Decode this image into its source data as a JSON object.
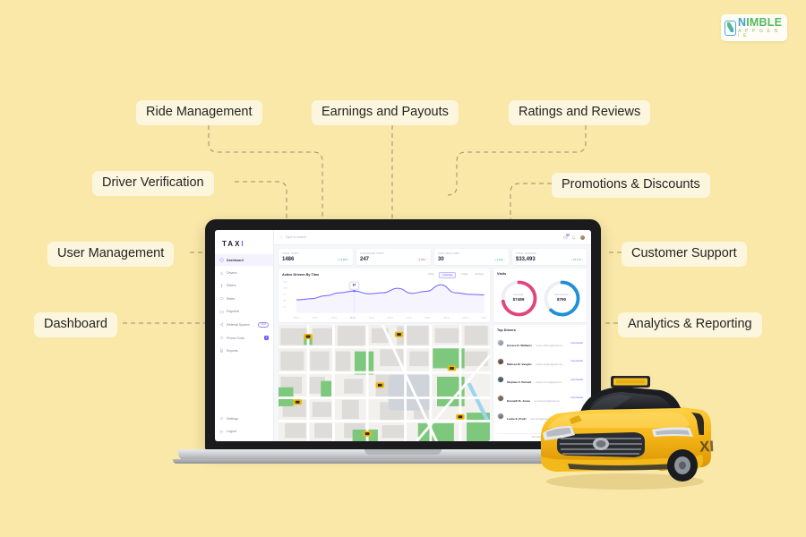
{
  "brand": {
    "name_part1": "N",
    "name_part2": "IMBLE",
    "tagline": "A P P G E N I E"
  },
  "callouts": [
    {
      "id": "ride-management",
      "label": "Ride Management"
    },
    {
      "id": "earnings-payouts",
      "label": "Earnings and Payouts"
    },
    {
      "id": "ratings-reviews",
      "label": "Ratings and Reviews"
    },
    {
      "id": "driver-verification",
      "label": "Driver Verification"
    },
    {
      "id": "promotions-discounts",
      "label": "Promotions & Discounts"
    },
    {
      "id": "user-management",
      "label": "User Management"
    },
    {
      "id": "customer-support",
      "label": "Customer Support"
    },
    {
      "id": "dashboard",
      "label": "Dashboard"
    },
    {
      "id": "analytics-reporting",
      "label": "Analytics & Reporting"
    }
  ],
  "dashboard": {
    "logo_text": "TAX",
    "logo_accent": "I",
    "search_placeholder": "Type to search",
    "sidebar": {
      "items": [
        {
          "label": "Dashboard",
          "icon": "gauge-icon",
          "active": true,
          "badge": ""
        },
        {
          "label": "Drivers",
          "icon": "user-icon",
          "active": false,
          "badge": ""
        },
        {
          "label": "Riders",
          "icon": "riders-icon",
          "active": false,
          "badge": ""
        },
        {
          "label": "Rides",
          "icon": "car-icon",
          "active": false,
          "badge": ""
        },
        {
          "label": "Payment",
          "icon": "wallet-icon",
          "active": false,
          "badge": ""
        },
        {
          "label": "Referral System",
          "icon": "share-icon",
          "active": false,
          "badge": "NEW"
        },
        {
          "label": "Promo Code",
          "icon": "tag-icon",
          "active": false,
          "badge": "3"
        },
        {
          "label": "Reports",
          "icon": "doc-icon",
          "active": false,
          "badge": ""
        }
      ],
      "bottom_items": [
        {
          "label": "Settings",
          "icon": "gear-icon"
        },
        {
          "label": "Logout",
          "icon": "logout-icon"
        }
      ]
    },
    "topbar": {
      "messages_badge": "2"
    },
    "stats": [
      {
        "label": "Total Trips",
        "value": "1486",
        "delta": "+ 14.58% ↑",
        "dir": "up"
      },
      {
        "label": "Cancelled Trips",
        "value": "247",
        "delta": "- 6.08% ↓",
        "dir": "down"
      },
      {
        "label": "Available Cabs",
        "value": "30",
        "delta": "+ 3.04% ↑",
        "dir": "up"
      },
      {
        "label": "Total Earning",
        "value": "$33,493",
        "delta": "+ 18.17% ↑",
        "dir": "up"
      }
    ],
    "chart_card": {
      "title": "Active Drivers By Time",
      "segments": [
        "Today",
        "Yesterday",
        "7 Days",
        "30 Days"
      ],
      "active_segment": "Yesterday",
      "tooltip": "87"
    },
    "visits": {
      "title": "Visits",
      "items": [
        {
          "caption": "New Visits",
          "value": "$7489",
          "color": "#e0457b",
          "percent": 72
        },
        {
          "caption": "Returned Visits",
          "value": "$790",
          "color": "#1f8fd6",
          "percent": 62
        }
      ]
    },
    "top_drivers": {
      "title": "Top Drivers",
      "link_label": "View Details",
      "see_all": "See All Drivers  ›",
      "rows": [
        {
          "name": "Horace R. Williams",
          "email": "horace.williams@gmail.com",
          "color1": "#b9c2cc",
          "color2": "#7b8896"
        },
        {
          "name": "Melissa M. Vaughn",
          "email": "melissa.vaughn@gmail.com",
          "color1": "#8d6f5c",
          "color2": "#4a372b"
        },
        {
          "name": "Stephen F. Burnett",
          "email": "stephen.burnett@gmail.com",
          "color1": "#6d7b86",
          "color2": "#3a454e"
        },
        {
          "name": "Kenneth B. Jones",
          "email": "kenneth.jones@gmail.com",
          "color1": "#a08a74",
          "color2": "#5d4a39"
        },
        {
          "name": "Leslie E. Pruitt",
          "email": "leslie.pruitt@gmail.com",
          "color1": "#9aa3ad",
          "color2": "#5a636c"
        }
      ]
    },
    "chart_data": {
      "type": "line",
      "title": "Active Drivers By Time",
      "xlabel": "",
      "ylabel": "",
      "ylim": [
        0,
        125
      ],
      "yticks": [
        25,
        50,
        75,
        100,
        125
      ],
      "ytick_labels": [
        "25",
        "50",
        "75",
        "100",
        "125"
      ],
      "x": [
        "08am",
        "09am",
        "10am",
        "11am",
        "12pm",
        "01pm",
        "02pm",
        "03pm",
        "04pm",
        "05pm",
        "06pm"
      ],
      "highlight_x": "11am",
      "series": [
        {
          "name": "Active Drivers",
          "values": [
            52,
            56,
            68,
            80,
            87,
            76,
            80,
            98,
            78,
            86,
            112,
            80,
            74,
            72
          ]
        }
      ],
      "grid": false,
      "legend": "none"
    }
  },
  "colors": {
    "page_bg": "#fae8a8",
    "label_bg": "#fdf6df",
    "accent": "#6c63ff",
    "positive": "#2fb37a",
    "negative": "#e8566d",
    "taxi_yellow": "#f0b323"
  }
}
